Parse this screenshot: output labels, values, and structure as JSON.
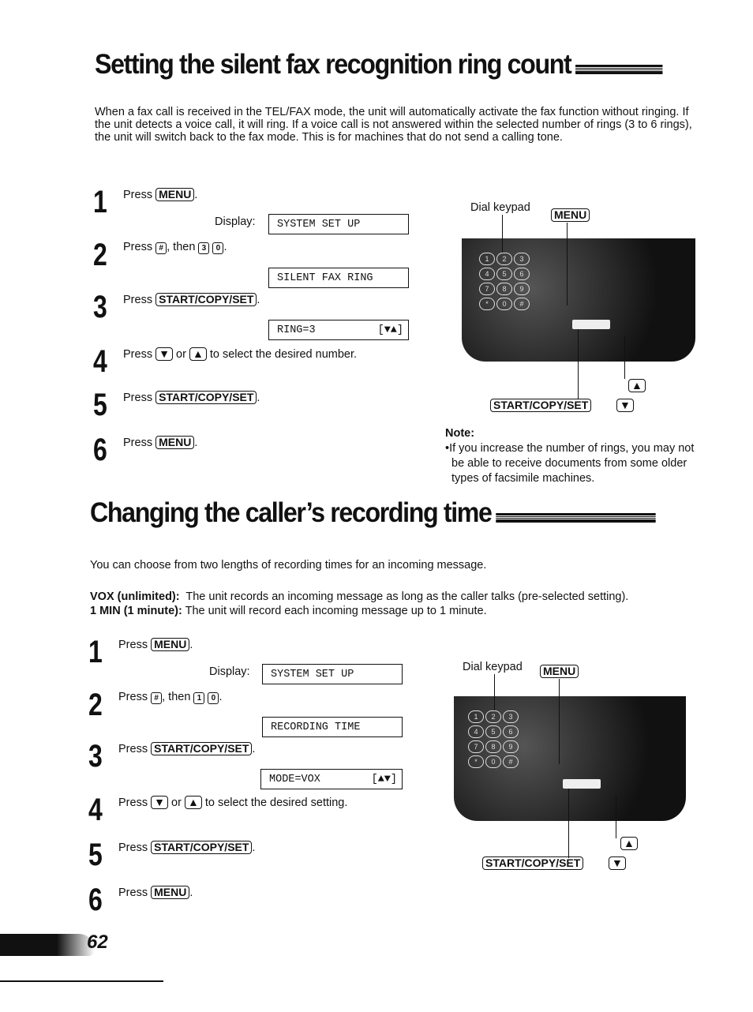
{
  "section1": {
    "title": "Setting the silent fax recognition ring count",
    "intro": "When a fax call is received in the TEL/FAX mode, the unit will automatically activate the fax function without ringing. If the unit detects a voice call, it will ring. If a voice call is not answered within the selected number of rings (3 to 6 rings), the unit will switch back to the fax mode. This is for machines that do not send a calling tone.",
    "steps": [
      {
        "num": "1",
        "pre": "Press",
        "key": "MENU",
        "post": "."
      },
      {
        "num": "2",
        "pre": "Press",
        "key": "#",
        "mid": ", then",
        "k2": "3",
        "k3": "0",
        "post": "."
      },
      {
        "num": "3",
        "pre": "Press",
        "key": "START/COPY/SET",
        "post": "."
      },
      {
        "num": "4",
        "pre": "Press",
        "key": "▼",
        "mid": "or",
        "k2": "▲",
        "post": "to select the desired number."
      },
      {
        "num": "5",
        "pre": "Press",
        "key": "START/COPY/SET",
        "post": "."
      },
      {
        "num": "6",
        "pre": "Press",
        "key": "MENU",
        "post": "."
      }
    ],
    "display_label": "Display:",
    "displays": [
      {
        "text": "SYSTEM SET UP"
      },
      {
        "text": "SILENT FAX RING"
      },
      {
        "text": "RING=3",
        "arrows": "[▼▲]"
      }
    ],
    "diagram": {
      "dial_keypad": "Dial keypad",
      "menu": "MENU",
      "start": "START/COPY/SET",
      "down": "▼",
      "up": "▲"
    },
    "note": {
      "heading": "Note:",
      "text": "•If you increase the number of rings, you may not be able to receive documents from some older types of facsimile machines."
    }
  },
  "section2": {
    "title": "Changing the caller’s recording time",
    "intro": "You can choose from two lengths of recording times for an incoming message.",
    "options": [
      {
        "label": "VOX (unlimited):",
        "text": "The unit records an incoming message as long as the caller talks (pre-selected setting)."
      },
      {
        "label": "1 MIN (1 minute):",
        "text": "The unit will record each incoming message up to 1 minute."
      }
    ],
    "steps": [
      {
        "num": "1",
        "pre": "Press",
        "key": "MENU",
        "post": "."
      },
      {
        "num": "2",
        "pre": "Press",
        "key": "#",
        "mid": ", then",
        "k2": "1",
        "k3": "0",
        "post": "."
      },
      {
        "num": "3",
        "pre": "Press",
        "key": "START/COPY/SET",
        "post": "."
      },
      {
        "num": "4",
        "pre": "Press",
        "key": "▼",
        "mid": "or",
        "k2": "▲",
        "post": "to select the desired setting."
      },
      {
        "num": "5",
        "pre": "Press",
        "key": "START/COPY/SET",
        "post": "."
      },
      {
        "num": "6",
        "pre": "Press",
        "key": "MENU",
        "post": "."
      }
    ],
    "display_label": "Display:",
    "displays": [
      {
        "text": "SYSTEM SET UP"
      },
      {
        "text": "RECORDING TIME"
      },
      {
        "text": "MODE=VOX",
        "arrows": "[▲▼]"
      }
    ],
    "diagram": {
      "dial_keypad": "Dial keypad",
      "menu": "MENU",
      "start": "START/COPY/SET",
      "down": "▼",
      "up": "▲"
    }
  },
  "keypad": [
    "1",
    "2",
    "3",
    "4",
    "5",
    "6",
    "7",
    "8",
    "9",
    "*",
    "0",
    "#"
  ],
  "page_number": "62"
}
